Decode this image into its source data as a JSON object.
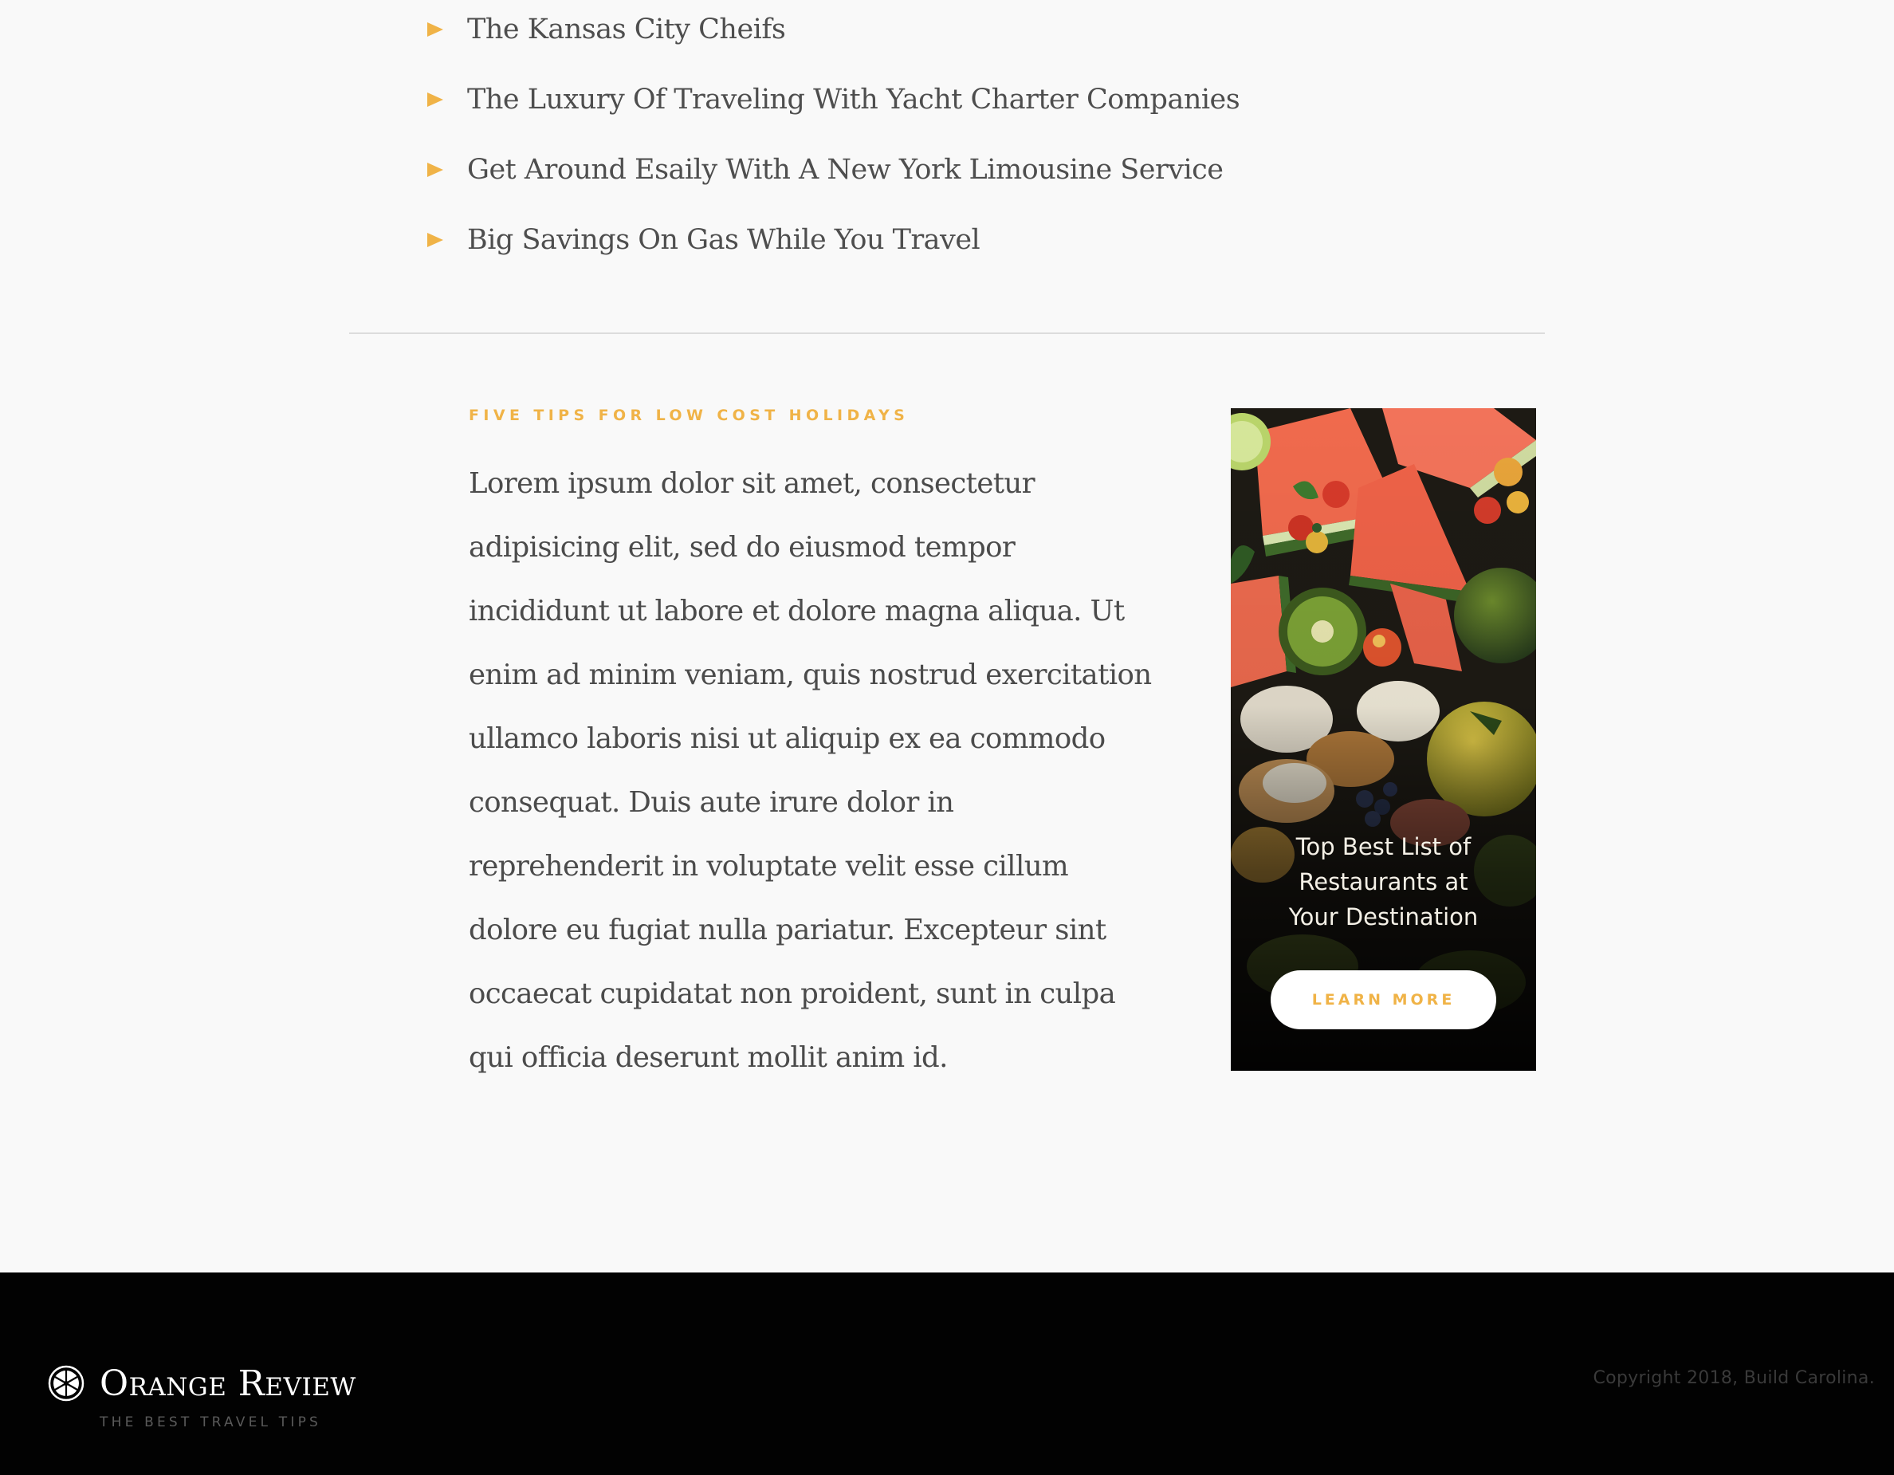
{
  "related_posts": [
    {
      "label": "The Kansas City Cheifs"
    },
    {
      "label": "The Luxury Of Traveling With Yacht Charter Companies"
    },
    {
      "label": "Get Around Esaily With A New York Limousine Service"
    },
    {
      "label": "Big Savings On Gas While You Travel"
    }
  ],
  "article": {
    "kicker": "FIVE TIPS FOR LOW COST HOLIDAYS",
    "body": "Lorem ipsum dolor sit amet, consectetur adipisicing elit, sed do eiusmod tempor incididunt ut labore et dolore magna aliqua. Ut enim ad minim veniam, quis nostrud exercitation ullamco laboris nisi ut aliquip ex ea commodo consequat. Duis aute irure dolor in reprehenderit in voluptate velit esse cillum dolore eu fugiat nulla pariatur. Excepteur sint occaecat cupidatat non proident, sunt in culpa qui officia deserunt mollit anim id."
  },
  "promo": {
    "title": "Top Best List of Restaurants at Your Destination",
    "button_label": "LEARN MORE",
    "image_icon": "fruit-platter-photo"
  },
  "footer": {
    "brand_name": "Orange Review",
    "brand_tagline": "THE BEST TRAVEL TIPS",
    "logo_icon": "orange-slice-icon",
    "copyright": "Copyright 2018, Build Carolina."
  },
  "colors": {
    "accent": "#f0b347",
    "background": "#f9f9f9",
    "footer_background": "#020202",
    "text": "#4b4b4b"
  }
}
